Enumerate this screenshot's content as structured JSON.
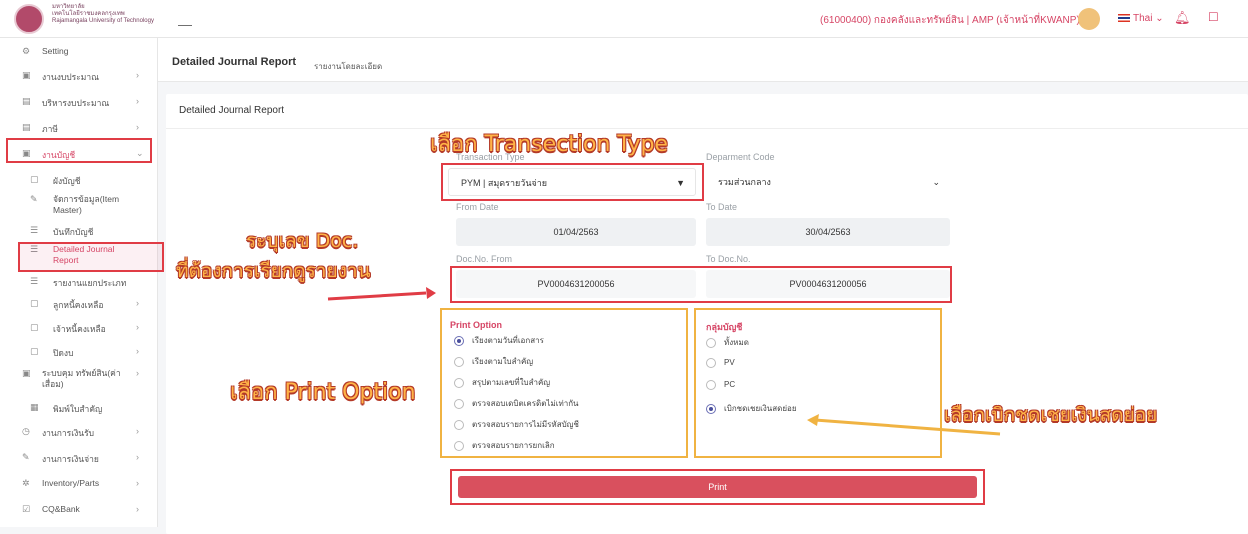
{
  "header": {
    "logo_text_line1": "มหาวิทยาลัย",
    "logo_text_line2": "เทคโนโลยีราชมงคลกรุงเทพ",
    "logo_text_line3": "Rajamangala University of Technology",
    "user": "(61000400) กองคลังและทรัพย์สิน | AMP (เจ้าหน้าที่KWANP)",
    "language": "Thai"
  },
  "sidebar": {
    "items": [
      {
        "label": "Setting"
      },
      {
        "label": "งานงบประมาณ"
      },
      {
        "label": "บริหารงบประมาณ"
      },
      {
        "label": "ภาษี"
      },
      {
        "label": "งานบัญชี"
      },
      {
        "label": "ผังบัญชี"
      },
      {
        "label": "จัดการข้อมูล(Item Master)"
      },
      {
        "label": "บันทึกบัญชี"
      },
      {
        "label": "Detailed Journal Report"
      },
      {
        "label": "รายงานแยกประเภท"
      },
      {
        "label": "ลูกหนี้คงเหลือ"
      },
      {
        "label": "เจ้าหนี้คงเหลือ"
      },
      {
        "label": "ปิดงบ"
      },
      {
        "label": "ระบบคุม ทรัพย์สิน(ค่าเสื่อม)"
      },
      {
        "label": "พิมพ์ใบสำคัญ"
      },
      {
        "label": "งานการเงินรับ"
      },
      {
        "label": "งานการเงินจ่าย"
      },
      {
        "label": "Inventory/Parts"
      },
      {
        "label": "CQ&Bank"
      }
    ]
  },
  "page": {
    "title": "Detailed Journal Report",
    "subtitle": "รายงานโดยละเอียด",
    "card_title": "Detailed Journal Report"
  },
  "form": {
    "transaction_type_label": "Transaction Type",
    "transaction_type_value": "PYM | สมุดรายวันจ่าย",
    "department_label": "Deparment Code",
    "department_value": "รวมส่วนกลาง",
    "from_date_label": "From Date",
    "from_date_value": "01/04/2563",
    "to_date_label": "To Date",
    "to_date_value": "30/04/2563",
    "doc_from_label": "Doc.No. From",
    "doc_from_value": "PV0004631200056",
    "doc_to_label": "To Doc.No.",
    "doc_to_value": "PV0004631200056"
  },
  "print_option": {
    "title": "Print Option",
    "options": [
      "เรียงตามวันที่เอกสาร",
      "เรียงตามใบสำคัญ",
      "สรุปตามเลขที่ใบสำคัญ",
      "ตรวจสอบเดบิตเครดิตไม่เท่ากัน",
      "ตรวจสอบรายการไม่มีรหัสบัญชี",
      "ตรวจสอบรายการยกเลิก"
    ],
    "selected": 0
  },
  "account_group": {
    "title": "กลุ่มบัญชี",
    "options": [
      "ทั้งหมด",
      "PV",
      "PC",
      "เบิกชดเชยเงินสดย่อย"
    ],
    "selected": 3
  },
  "print_button": "Print",
  "annotations": {
    "transaction": "เลือก Transection Type",
    "doc_line1": "ระบุเลข Doc.",
    "doc_line2": "ที่ต้องการเรียกดูรายงาน",
    "print_option": "เลือก Print Option",
    "petty_cash": "เลือกเบิกชดเชยเงินสดย่อย"
  },
  "colors": {
    "accent": "#d64565",
    "highlight_red": "#e03c45",
    "highlight_orange": "#f0b342",
    "print_button": "#d9505e"
  }
}
